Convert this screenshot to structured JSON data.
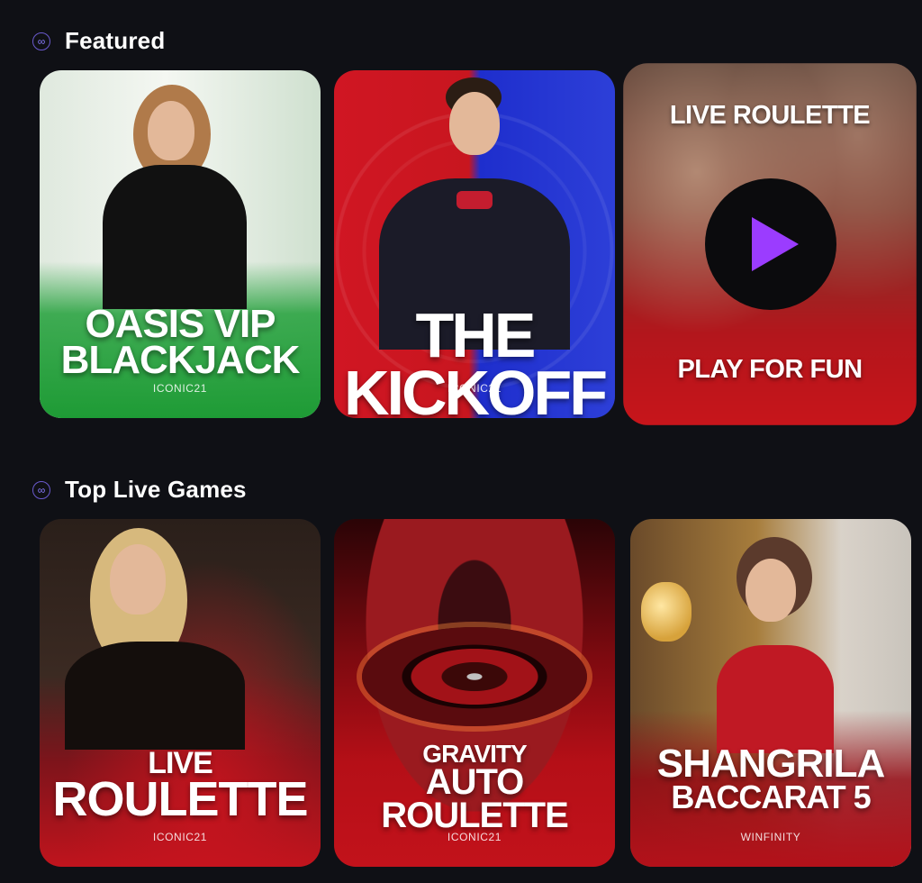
{
  "sections": {
    "featured": {
      "title": "Featured",
      "cards": [
        {
          "title_line1": "OASIS VIP",
          "title_line2": "BLACKJACK",
          "provider": "ICONIC21"
        },
        {
          "title": "THE KICKOFF",
          "provider": "ICONIC21"
        },
        {
          "top_text": "LIVE ROULETTE",
          "bottom_text": "PLAY FOR FUN"
        }
      ]
    },
    "top_live": {
      "title": "Top Live Games",
      "cards": [
        {
          "title_line1": "LIVE",
          "title_line2": "ROULETTE",
          "provider": "ICONIC21"
        },
        {
          "title_line1": "GRAVITY",
          "title_line2": "AUTO",
          "title_line3": "ROULETTE",
          "provider": "ICONIC21"
        },
        {
          "title_line1": "SHANGRILA",
          "title_line2": "BACCARAT 5",
          "provider": "WINFINITY"
        }
      ]
    }
  },
  "colors": {
    "background": "#0f1015",
    "section_icon": "#8a7dff",
    "play_triangle": "#9b3cff"
  },
  "icons": {
    "section": "infinity-icon",
    "play": "play-icon"
  }
}
